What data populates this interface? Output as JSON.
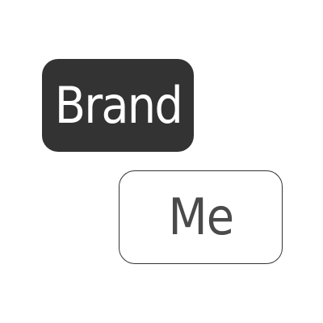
{
  "logo": {
    "primary_word": "Brand",
    "secondary_word": "Me"
  },
  "colors": {
    "dark_box": "#333333",
    "text_on_dark": "#ffffff",
    "text_on_light": "#4a4a4a",
    "outline": "#333333",
    "background": "#ffffff"
  }
}
